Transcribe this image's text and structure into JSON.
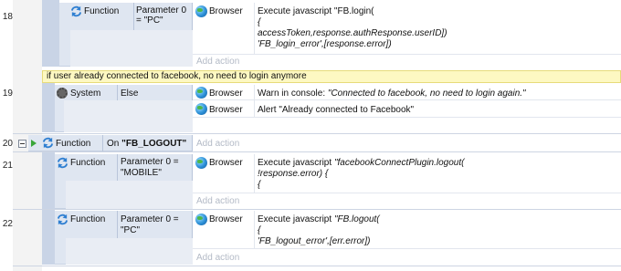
{
  "rows": {
    "r18": "18",
    "r19": "19",
    "r20": "20",
    "r21": "21",
    "r22": "22"
  },
  "row18": {
    "object": "Function",
    "param_line1": "Parameter 0",
    "param_line2": "= \"PC\"",
    "action_object": "Browser",
    "line1": "Execute javascript \"FB.login(",
    "line2": "{",
    "line3": "accessToken,response.authResponse.userID])",
    "line4": "'FB_login_error',[response.error])",
    "add_action": "Add action"
  },
  "comment": "if user already connected to facebook, no need to login anymore",
  "row19": {
    "object": "System",
    "condition": "Else",
    "action1_object": "Browser",
    "action1_prefix": "Warn in console: ",
    "action1_italic": "\"Connected to facebook, no need to login again.\"",
    "action2_object": "Browser",
    "action2_text": "Alert \"Already connected to Facebook\""
  },
  "row20": {
    "object": "Function",
    "on_prefix": "On ",
    "on_name": "\"FB_LOGOUT\"",
    "add_action": "Add action"
  },
  "row21": {
    "object": "Function",
    "param_line1": "Parameter 0 =",
    "param_line2": "\"MOBILE\"",
    "action_object": "Browser",
    "line1_prefix": "Execute javascript ",
    "line1_italic": "\"facebookConnectPlugin.logout(",
    "line2": "!response.error) {",
    "line3": "{",
    "add_action": "Add action"
  },
  "row22": {
    "object": "Function",
    "param_line1": "Parameter 0 =",
    "param_line2": "\"PC\"",
    "action_object": "Browser",
    "line1_prefix": "Execute javascript ",
    "line1_italic": "\"FB.logout(",
    "line2": "{",
    "line3": "'FB_logout_error',[err.error])",
    "add_action": "Add action"
  },
  "colors": {
    "event_bg": "#dfe6f1",
    "band": "#c9d4e6",
    "comment_bg": "#fdf8c2",
    "add_action": "#b3bac6"
  },
  "icons": {
    "function": "refresh-arrows-icon",
    "browser": "globe-icon",
    "system": "gear-icon",
    "trigger": "green-arrow-icon"
  }
}
